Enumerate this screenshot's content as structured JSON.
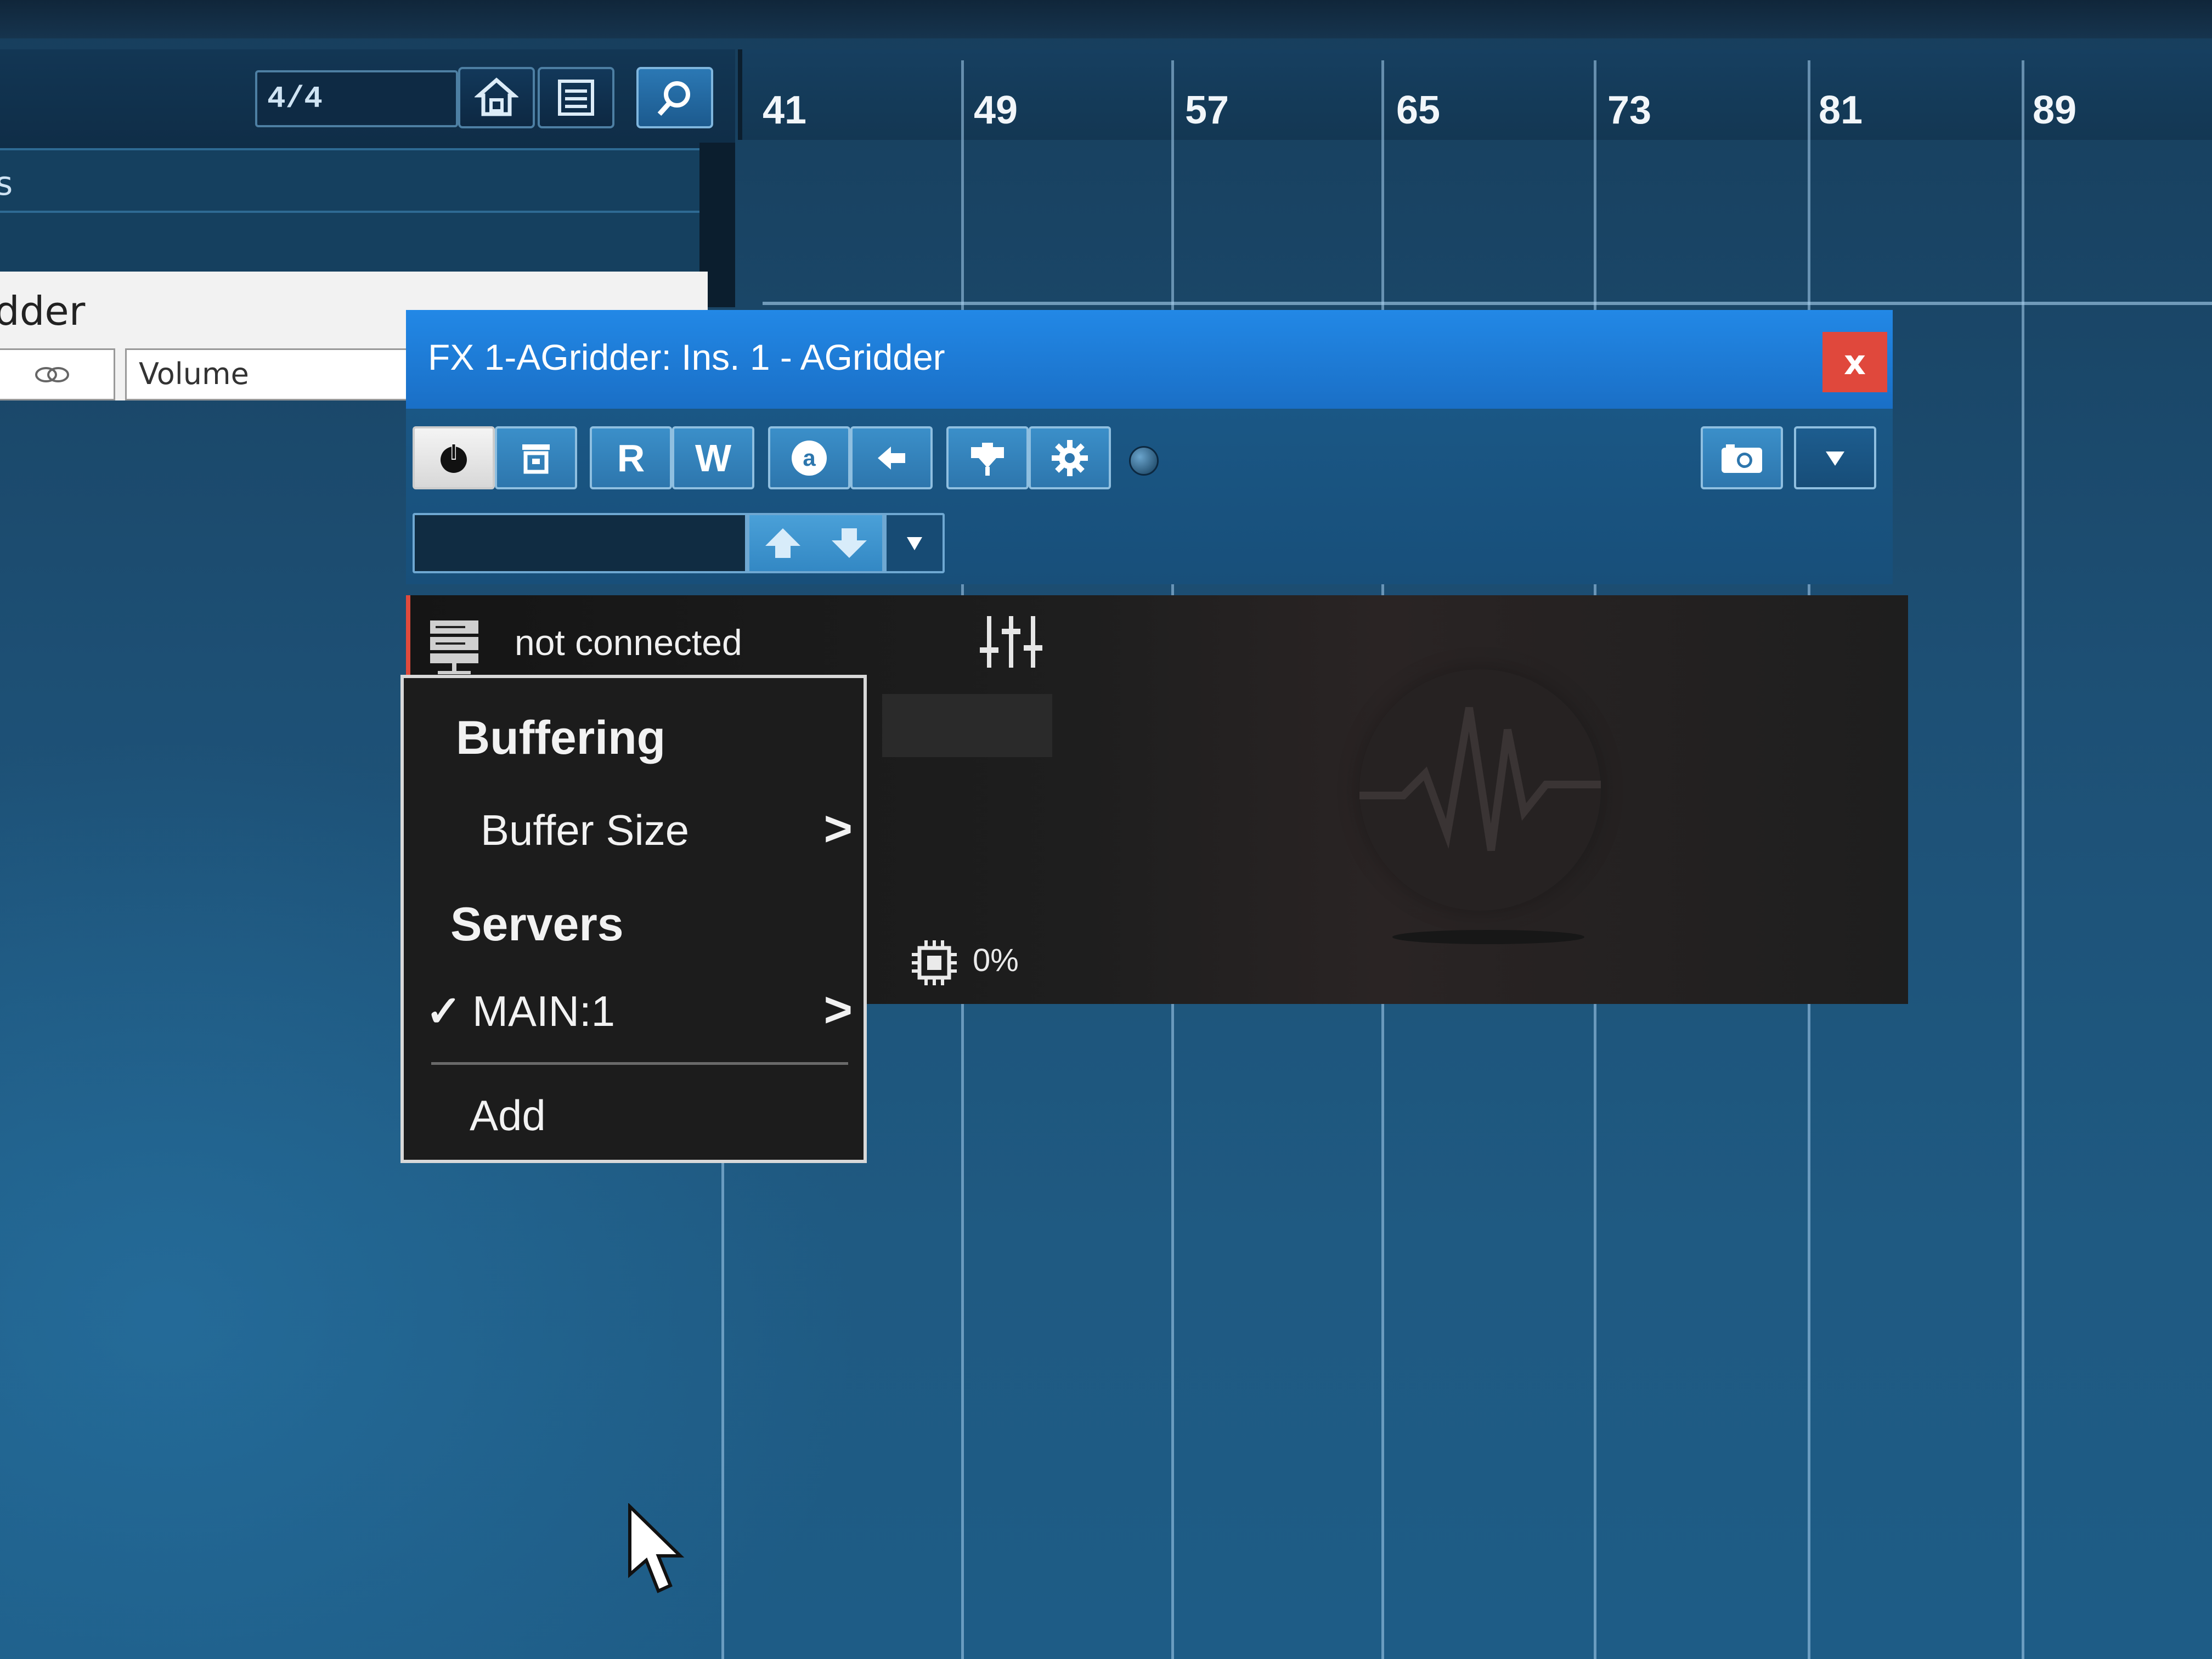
{
  "toolbar": {
    "time_signature": "4/4",
    "icons": [
      "snap-home-icon",
      "list-icon",
      "search-icon"
    ]
  },
  "track": {
    "header_fragment": "s",
    "name_fragment": "dder",
    "automation_param": "Volume",
    "link_icon": "link-icon"
  },
  "ruler": {
    "bars": [
      "41",
      "49",
      "57",
      "65",
      "73",
      "81",
      "89"
    ]
  },
  "plugin": {
    "title": "FX 1-AGridder: Ins. 1 - AGridder",
    "close_label": "x",
    "buttons": {
      "read": "R",
      "write": "W"
    },
    "connection_status": "not connected",
    "cpu_usage": "0%",
    "colors": {
      "titlebar": "#1f7fdc",
      "close": "#e0483c",
      "accent_border": "#e04a3c"
    }
  },
  "context_menu": {
    "section_buffering": "Buffering",
    "buffer_size": "Buffer Size",
    "section_servers": "Servers",
    "server_checkmark": "✓",
    "server_main": "MAIN:1",
    "add": "Add"
  }
}
